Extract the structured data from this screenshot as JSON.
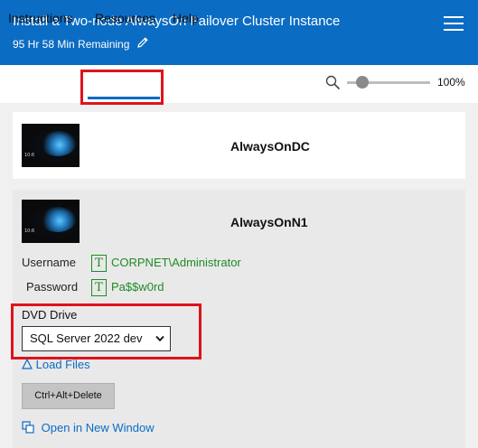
{
  "header": {
    "title": "Install a Two-node AlwaysOn Failover Cluster Instance",
    "remaining": "95 Hr 58 Min Remaining",
    "edit_icon": "pencil-icon",
    "menu_icon": "hamburger-menu-icon"
  },
  "tabs": [
    {
      "label": "Instructions",
      "active": false
    },
    {
      "label": "Resources",
      "active": true
    },
    {
      "label": "Help",
      "active": false
    }
  ],
  "zoom": {
    "icon": "search-icon",
    "value_label": "100%",
    "level": 1.0
  },
  "resources": [
    {
      "name": "AlwaysOnDC",
      "thumbnail_clock": "10:6"
    },
    {
      "name": "AlwaysOnN1",
      "thumbnail_clock": "10:6",
      "username_label": "Username",
      "username_value": "CORPNET\\Administrator",
      "password_label": "Password",
      "password_value": "Pa$$w0rd",
      "type_icon_text": "T",
      "dvd_label": "DVD Drive",
      "dvd_selected": "SQL Server 2022 dev",
      "load_files_label": "Load Files",
      "cad_button_label": "Ctrl+Alt+Delete",
      "open_window_label": "Open in New Window"
    }
  ],
  "colors": {
    "header_bg": "#0b6cc4",
    "accent": "#0b6cc4",
    "highlight_box": "#e0121c",
    "credential_text": "#1f8b25"
  }
}
